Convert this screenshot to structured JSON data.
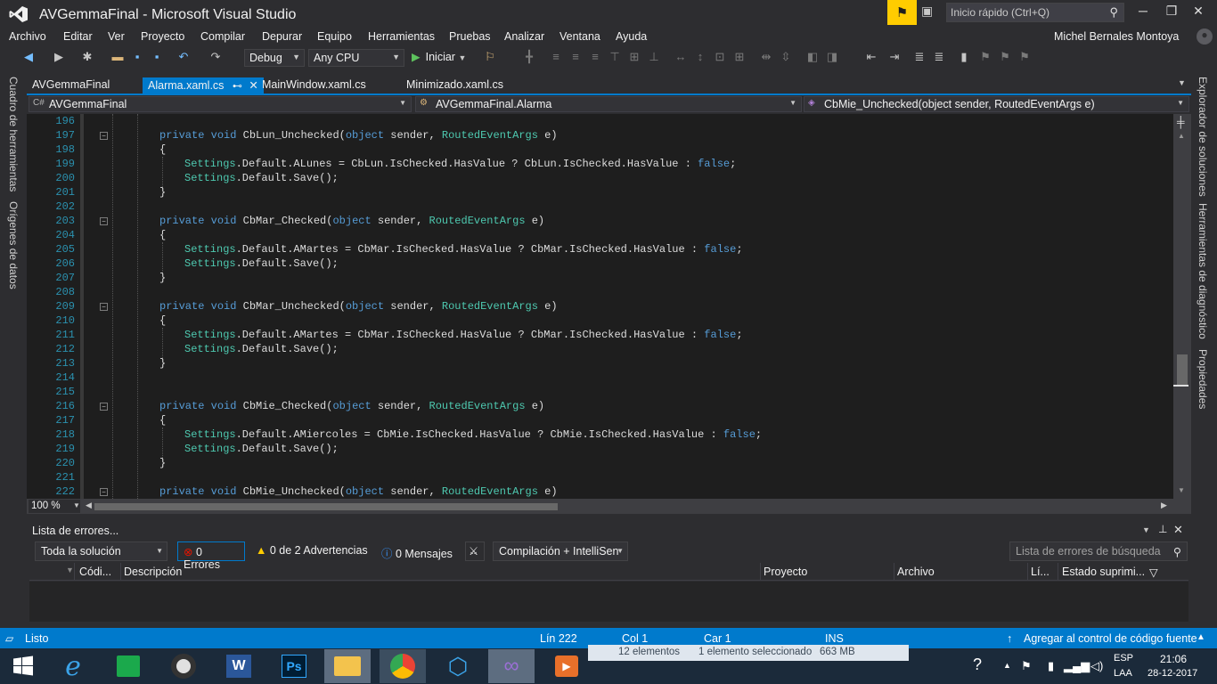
{
  "window": {
    "title": "AVGemmaFinal - Microsoft Visual Studio",
    "quick_launch_placeholder": "Inicio rápido (Ctrl+Q)",
    "user": "Michel Bernales Montoya"
  },
  "menu": [
    "Archivo",
    "Editar",
    "Ver",
    "Proyecto",
    "Compilar",
    "Depurar",
    "Equipo",
    "Herramientas",
    "Pruebas",
    "Analizar",
    "Ventana",
    "Ayuda"
  ],
  "toolbar": {
    "config": "Debug",
    "platform": "Any CPU",
    "start_label": "Iniciar"
  },
  "left_rail": [
    "Cuadro de herramientas",
    "Orígenes de datos"
  ],
  "right_rail": [
    "Explorador de soluciones",
    "Herramientas de diagnóstico",
    "Propiedades"
  ],
  "tabs": [
    {
      "label": "AVGemmaFinal",
      "active": false
    },
    {
      "label": "Alarma.xaml.cs",
      "active": true,
      "pin": "⊷"
    },
    {
      "label": "MainWindow.xaml.cs",
      "active": false
    },
    {
      "label": "Minimizado.xaml.cs",
      "active": false
    }
  ],
  "navbar": {
    "project": "AVGemmaFinal",
    "class": "AVGemmaFinal.Alarma",
    "member": "CbMie_Unchecked(object sender, RoutedEventArgs e)"
  },
  "code_lines": [
    {
      "n": "196",
      "t": ""
    },
    {
      "n": "197",
      "t": "private void CbLun_Unchecked(object sender, RoutedEventArgs e)",
      "kind": "sig",
      "fold": true
    },
    {
      "n": "198",
      "t": "{"
    },
    {
      "n": "199",
      "t": "Settings.Default.ALunes = CbLun.IsChecked.HasValue ? CbLun.IsChecked.HasValue : false;",
      "kind": "body"
    },
    {
      "n": "200",
      "t": "Settings.Default.Save();",
      "kind": "body"
    },
    {
      "n": "201",
      "t": "}"
    },
    {
      "n": "202",
      "t": ""
    },
    {
      "n": "203",
      "t": "private void CbMar_Checked(object sender, RoutedEventArgs e)",
      "kind": "sig",
      "fold": true
    },
    {
      "n": "204",
      "t": "{"
    },
    {
      "n": "205",
      "t": "Settings.Default.AMartes = CbMar.IsChecked.HasValue ? CbMar.IsChecked.HasValue : false;",
      "kind": "body"
    },
    {
      "n": "206",
      "t": "Settings.Default.Save();",
      "kind": "body"
    },
    {
      "n": "207",
      "t": "}"
    },
    {
      "n": "208",
      "t": ""
    },
    {
      "n": "209",
      "t": "private void CbMar_Unchecked(object sender, RoutedEventArgs e)",
      "kind": "sig",
      "fold": true
    },
    {
      "n": "210",
      "t": "{"
    },
    {
      "n": "211",
      "t": "Settings.Default.AMartes = CbMar.IsChecked.HasValue ? CbMar.IsChecked.HasValue : false;",
      "kind": "body"
    },
    {
      "n": "212",
      "t": "Settings.Default.Save();",
      "kind": "body"
    },
    {
      "n": "213",
      "t": "}"
    },
    {
      "n": "214",
      "t": ""
    },
    {
      "n": "215",
      "t": ""
    },
    {
      "n": "216",
      "t": "private void CbMie_Checked(object sender, RoutedEventArgs e)",
      "kind": "sig",
      "fold": true
    },
    {
      "n": "217",
      "t": "{"
    },
    {
      "n": "218",
      "t": "Settings.Default.AMiercoles = CbMie.IsChecked.HasValue ? CbMie.IsChecked.HasValue : false;",
      "kind": "body"
    },
    {
      "n": "219",
      "t": "Settings.Default.Save();",
      "kind": "body"
    },
    {
      "n": "220",
      "t": "}"
    },
    {
      "n": "221",
      "t": ""
    },
    {
      "n": "222",
      "t": "private void CbMie_Unchecked(object sender, RoutedEventArgs e)",
      "kind": "sig",
      "fold": true
    }
  ],
  "editor": {
    "zoom": "100 %"
  },
  "error_list": {
    "title": "Lista de errores...",
    "scope": "Toda la solución",
    "errors": "0 Errores",
    "warnings": "0 de 2 Advertencias",
    "messages": "0 Mensajes",
    "build_filter": "Compilación + IntelliSen",
    "search_placeholder": "Lista de errores de búsqueda",
    "columns": [
      "Códi...",
      "Descripción",
      "Proyecto",
      "Archivo",
      "Lí...",
      "Estado suprimi..."
    ]
  },
  "status_bar": {
    "state": "Listo",
    "line": "Lín 222",
    "col": "Col 1",
    "car": "Car 1",
    "mode": "INS",
    "source_control": "Agregar al control de código fuente"
  },
  "explorer_strip": {
    "items": "12 elementos",
    "selected": "1 elemento seleccionado",
    "size": "663 MB"
  },
  "taskbar": {
    "lang": "ESP",
    "layout": "LAA",
    "time": "21:06",
    "date": "28-12-2017"
  },
  "colors": {
    "accent": "#007acc",
    "keyword": "#569cd6",
    "type": "#4ec9b0",
    "linenum": "#2b91af"
  }
}
